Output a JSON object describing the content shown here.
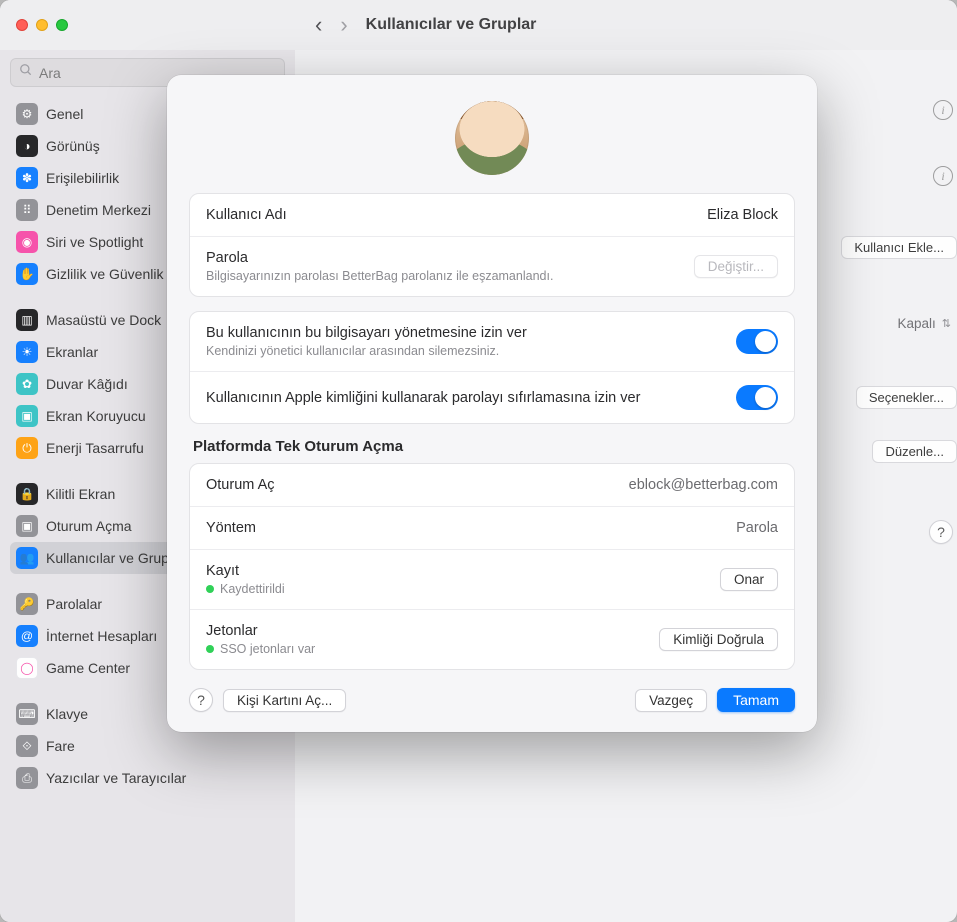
{
  "window": {
    "title": "Kullanıcılar ve Gruplar",
    "search_placeholder": "Ara"
  },
  "sidebar": {
    "items": [
      {
        "label": "Genel",
        "bg": "#8e8e93",
        "glyph": "⚙"
      },
      {
        "label": "Görünüş",
        "bg": "#1c1c1e",
        "glyph": "◑"
      },
      {
        "label": "Erişilebilirlik",
        "bg": "#0a7aff",
        "glyph": "✽"
      },
      {
        "label": "Denetim Merkezi",
        "bg": "#8e8e93",
        "glyph": "⠿"
      },
      {
        "label": "Siri ve Spotlight",
        "bg": "#f64ba7",
        "glyph": "◉"
      },
      {
        "label": "Gizlilik ve Güvenlik",
        "bg": "#0a7aff",
        "glyph": "✋"
      },
      {
        "gap": true
      },
      {
        "label": "Masaüstü ve Dock",
        "bg": "#1c1c1e",
        "glyph": "▥"
      },
      {
        "label": "Ekranlar",
        "bg": "#0a7aff",
        "glyph": "☀"
      },
      {
        "label": "Duvar Kâğıdı",
        "bg": "#34c2c4",
        "glyph": "✿"
      },
      {
        "label": "Ekran Koruyucu",
        "bg": "#34c2c4",
        "glyph": "▣"
      },
      {
        "label": "Enerji Tasarrufu",
        "bg": "#ff9f0a",
        "glyph": "⏻"
      },
      {
        "gap": true
      },
      {
        "label": "Kilitli Ekran",
        "bg": "#1c1c1e",
        "glyph": "🔒"
      },
      {
        "label": "Oturum Açma",
        "bg": "#8e8e93",
        "glyph": "▣"
      },
      {
        "label": "Kullanıcılar ve Gruplar",
        "bg": "#0a7aff",
        "glyph": "👥",
        "selected": true
      },
      {
        "gap": true
      },
      {
        "label": "Parolalar",
        "bg": "#8e8e93",
        "glyph": "🔑"
      },
      {
        "label": "İnternet Hesapları",
        "bg": "#0a7aff",
        "glyph": "@"
      },
      {
        "label": "Game Center",
        "bg": "#ffffff",
        "glyph": "◯"
      },
      {
        "gap": true
      },
      {
        "label": "Klavye",
        "bg": "#8e8e93",
        "glyph": "⌨"
      },
      {
        "label": "Fare",
        "bg": "#8e8e93",
        "glyph": "⟐"
      },
      {
        "label": "Yazıcılar ve Tarayıcılar",
        "bg": "#8e8e93",
        "glyph": "⎙"
      }
    ]
  },
  "background": {
    "add_user": "Kullanıcı Ekle...",
    "auto_login_value": "Kapalı",
    "network_options": "Seçenekler...",
    "edit": "Düzenle...",
    "help": "?"
  },
  "modal": {
    "username_label": "Kullanıcı Adı",
    "username_value": "Eliza Block",
    "password_label": "Parola",
    "password_sub": "Bilgisayarınızın parolası BetterBag parolanız ile eşzamanlandı.",
    "change_btn": "Değiştir...",
    "admin_label": "Bu kullanıcının bu bilgisayarı yönetmesine izin ver",
    "admin_sub": "Kendinizi yönetici kullanıcılar arasından silemezsiniz.",
    "admin_on": true,
    "appleid_reset_label": "Kullanıcının Apple kimliğini kullanarak parolayı sıfırlamasına izin ver",
    "appleid_reset_on": true,
    "sso_title": "Platformda Tek Oturum Açma",
    "signin_label": "Oturum Aç",
    "signin_value": "eblock@betterbag.com",
    "method_label": "Yöntem",
    "method_value": "Parola",
    "registration_label": "Kayıt",
    "registration_status": "Kaydettirildi",
    "repair_btn": "Onar",
    "tokens_label": "Jetonlar",
    "tokens_status": "SSO jetonları var",
    "verify_btn": "Kimliği Doğrula",
    "open_card_btn": "Kişi Kartını Aç...",
    "cancel_btn": "Vazgeç",
    "ok_btn": "Tamam",
    "help_glyph": "?"
  }
}
